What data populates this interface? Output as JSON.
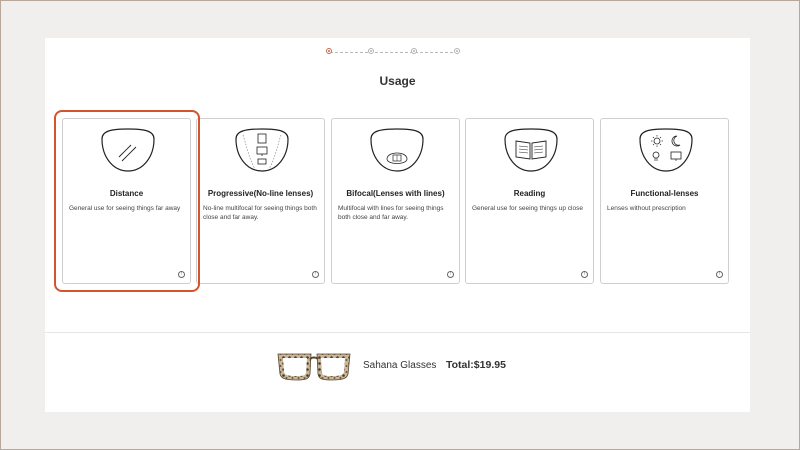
{
  "stepper": {
    "steps": 4,
    "current": 1
  },
  "page_title": "Usage",
  "options": [
    {
      "name": "Distance",
      "description": "General use for seeing things far away",
      "selected": true,
      "icon": "distance-lens-icon"
    },
    {
      "name": "Progressive(No-line lenses)",
      "description": "No-line multifocal for seeing things both close and far away.",
      "selected": false,
      "icon": "progressive-lens-icon"
    },
    {
      "name": "Bifocal(Lenses with lines)",
      "description": "Multifocal with lines for seeing things both close and far away.",
      "selected": false,
      "icon": "bifocal-lens-icon"
    },
    {
      "name": "Reading",
      "description": "General use for seeing things up close",
      "selected": false,
      "icon": "reading-lens-icon"
    },
    {
      "name": "Functional-lenses",
      "description": "Lenses without prescription",
      "selected": false,
      "icon": "functional-lens-icon"
    }
  ],
  "info_glyph": "!",
  "product": {
    "name": "Sahana Glasses",
    "total": "Total:$19.95"
  },
  "colors": {
    "accent": "#d2552b",
    "background": "#f0efee",
    "panel": "#ffffff"
  }
}
